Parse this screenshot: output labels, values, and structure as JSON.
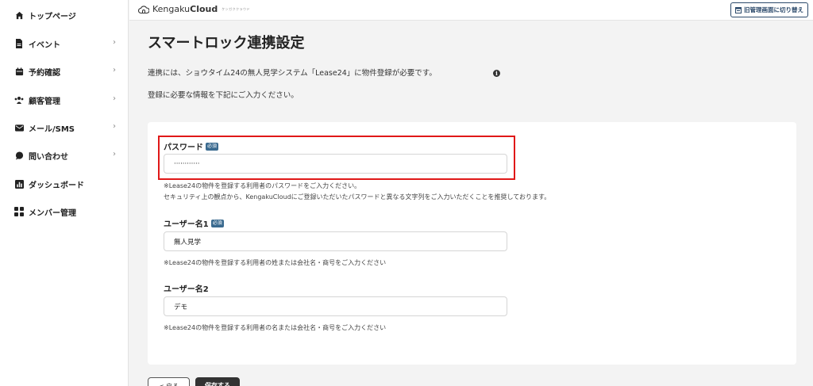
{
  "sidebar": {
    "items": [
      {
        "label": "トップページ",
        "icon": "home-icon",
        "has_chevron": false
      },
      {
        "label": "イベント",
        "icon": "document-icon",
        "has_chevron": true
      },
      {
        "label": "予約確認",
        "icon": "calendar-icon",
        "has_chevron": true
      },
      {
        "label": "顧客管理",
        "icon": "people-icon",
        "has_chevron": true
      },
      {
        "label": "メール/SMS",
        "icon": "mail-icon",
        "has_chevron": true
      },
      {
        "label": "問い合わせ",
        "icon": "chat-bubble-icon",
        "has_chevron": true
      },
      {
        "label": "ダッシュボード",
        "icon": "chart-icon",
        "has_chevron": false
      },
      {
        "label": "メンバー管理",
        "icon": "grid-icon",
        "has_chevron": false
      }
    ],
    "chevron": "›"
  },
  "header": {
    "brand_light": "Kengaku",
    "brand_bold": "Cloud",
    "brand_kana": "ケンガククラウド",
    "switch_label": "旧管理画面に切り替え"
  },
  "main": {
    "title": "スマートロック連携設定",
    "intro_line1": "連携には、ショウタイム24の無人見学システム「Lease24」に物件登録が必要です。",
    "info_icon": "i",
    "intro_line2": "登録に必要な情報を下記にご入力ください。"
  },
  "form": {
    "required_badge": "必須",
    "password": {
      "label": "パスワード",
      "value": "············",
      "help1": "※Lease24の物件を登録する利用者のパスワードをご入力ください。",
      "help2": "セキュリティ上の観点から、KengakuCloudにご登録いただいたパスワードと異なる文字列をご入力いただくことを推奨しております。"
    },
    "user1": {
      "label": "ユーザー名1",
      "value": "無人見学",
      "help": "※Lease24の物件を登録する利用者の姓または会社名・商号をご入力ください"
    },
    "user2": {
      "label": "ユーザー名2",
      "value": "デモ",
      "help": "※Lease24の物件を登録する利用者の名または会社名・商号をご入力ください"
    }
  },
  "actions": {
    "back_label": "< 戻る",
    "save_label": "保存する"
  },
  "colors": {
    "highlight": "#e01818",
    "badge": "#3a6a8f",
    "switch_border": "#2c4a6b"
  }
}
